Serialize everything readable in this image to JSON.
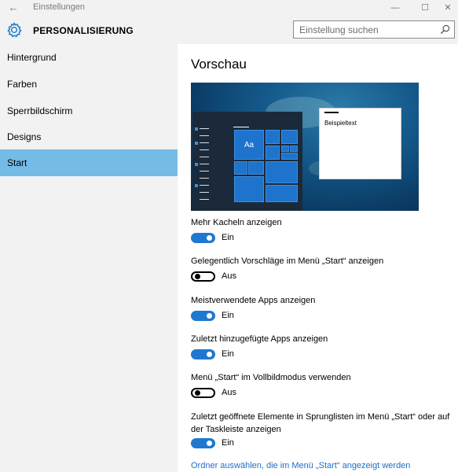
{
  "window": {
    "title": "Einstellungen",
    "back_icon": "back-arrow-icon",
    "min_glyph": "—",
    "max_glyph": "☐",
    "close_glyph": "✕"
  },
  "header": {
    "icon": "gear-icon",
    "title": "PERSONALISIERUNG",
    "search_placeholder": "Einstellung suchen"
  },
  "sidebar": {
    "selected_index": 4,
    "selected_color": "#74bbe6",
    "items": [
      {
        "label": "Hintergrund"
      },
      {
        "label": "Farben"
      },
      {
        "label": "Sperrbildschirm"
      },
      {
        "label": "Designs"
      },
      {
        "label": "Start"
      }
    ]
  },
  "main": {
    "preview_heading": "Vorschau",
    "preview": {
      "tile_label": "Aa",
      "sample_text": "Beispieltext",
      "accent_color": "#1e73cc"
    },
    "options": [
      {
        "label": "Mehr Kacheln anzeigen",
        "on": true,
        "state": "Ein"
      },
      {
        "label": "Gelegentlich Vorschläge im Menü „Start“ anzeigen",
        "on": false,
        "state": "Aus"
      },
      {
        "label": "Meistverwendete Apps anzeigen",
        "on": true,
        "state": "Ein"
      },
      {
        "label": "Zuletzt hinzugefügte Apps anzeigen",
        "on": true,
        "state": "Ein"
      },
      {
        "label": "Menü „Start“ im Vollbildmodus verwenden",
        "on": false,
        "state": "Aus"
      },
      {
        "label": "Zuletzt geöffnete Elemente in Sprunglisten im Menü „Start“ oder auf der Taskleiste anzeigen",
        "on": true,
        "state": "Ein"
      }
    ],
    "link": "Ordner auswählen, die im Menü „Start“ angezeigt werden",
    "toggle_on_color": "#1e78d0",
    "link_color": "#1e6fc7"
  }
}
